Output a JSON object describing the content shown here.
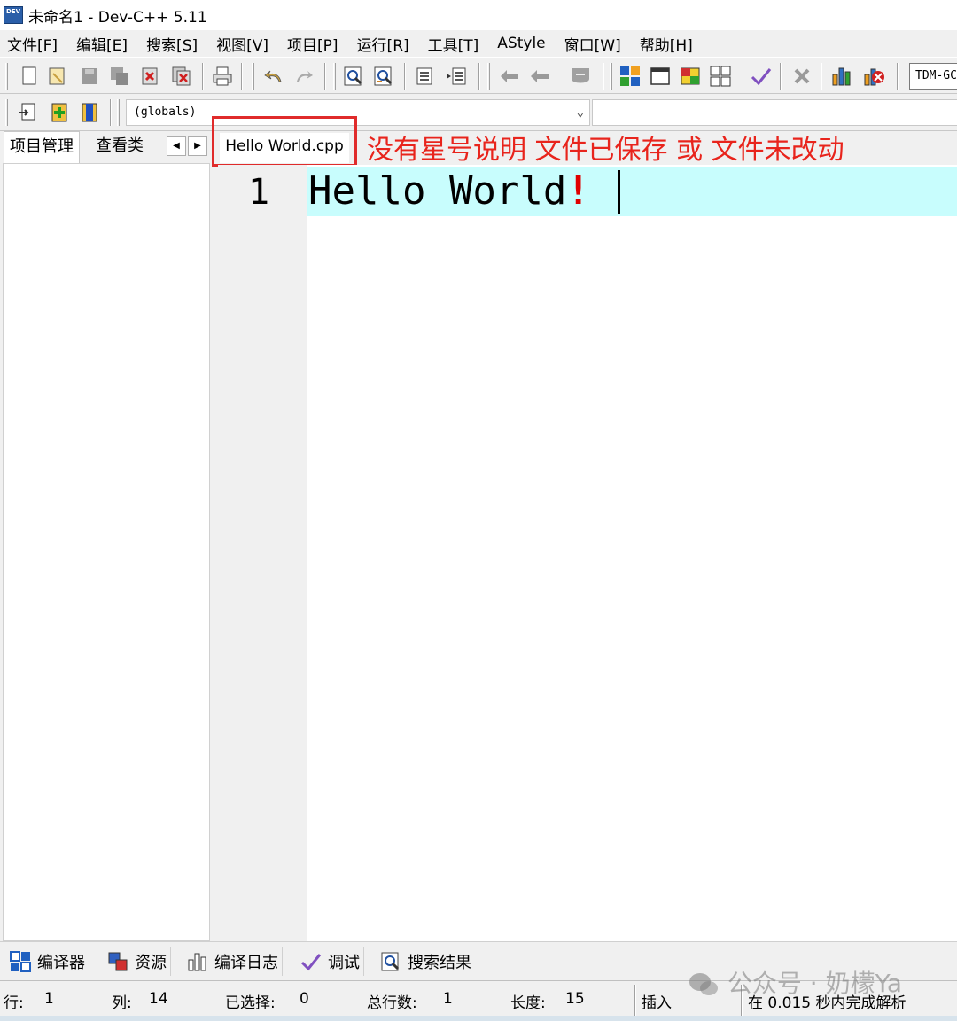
{
  "window": {
    "title": "未命名1 - Dev-C++ 5.11",
    "logo_text": "DEV"
  },
  "menu": [
    "文件[F]",
    "编辑[E]",
    "搜索[S]",
    "视图[V]",
    "项目[P]",
    "运行[R]",
    "工具[T]",
    "AStyle",
    "窗口[W]",
    "帮助[H]"
  ],
  "toolbar": {
    "compiler_profile": "TDM-GCC",
    "icons": [
      "new-file-icon",
      "open-file-icon",
      "save-icon",
      "save-all-icon",
      "close-icon",
      "close-all-icon",
      "print-icon",
      "undo-icon",
      "redo-icon",
      "find-icon",
      "replace-icon",
      "indent-icon",
      "unindent-icon",
      "bookmark-back-icon",
      "bookmark-forward-icon",
      "toggle-comment-icon",
      "new-project-icon",
      "window-icon",
      "new-class-icon",
      "project-view-icon",
      "check-icon",
      "stop-icon",
      "chart-icon",
      "debug-stop-icon"
    ]
  },
  "toolbar2": {
    "scope_select": "(globals)"
  },
  "left_panel": {
    "tab_project": "项目管理",
    "tab_class": "查看类"
  },
  "editor": {
    "tab_label": "Hello World.cpp",
    "annotation": "没有星号说明 文件已保存 或 文件未改动",
    "line_number": "1",
    "code_text": "Hello World",
    "code_bang": "!"
  },
  "bottom_tabs": [
    "编译器",
    "资源",
    "编译日志",
    "调试",
    "搜索结果"
  ],
  "status": {
    "row_label": "行:",
    "row_value": "1",
    "col_label": "列:",
    "col_value": "14",
    "sel_label": "已选择:",
    "sel_value": "0",
    "total_label": "总行数:",
    "total_value": "1",
    "len_label": "长度:",
    "len_value": "15",
    "mode": "插入",
    "parse_msg": "在 0.015 秒内完成解析"
  },
  "watermark": "公众号 · 奶檬Ya",
  "colors": {
    "annotation_red": "#e8241c",
    "active_line": "#c8fdfd",
    "bang_red": "#e00000"
  }
}
